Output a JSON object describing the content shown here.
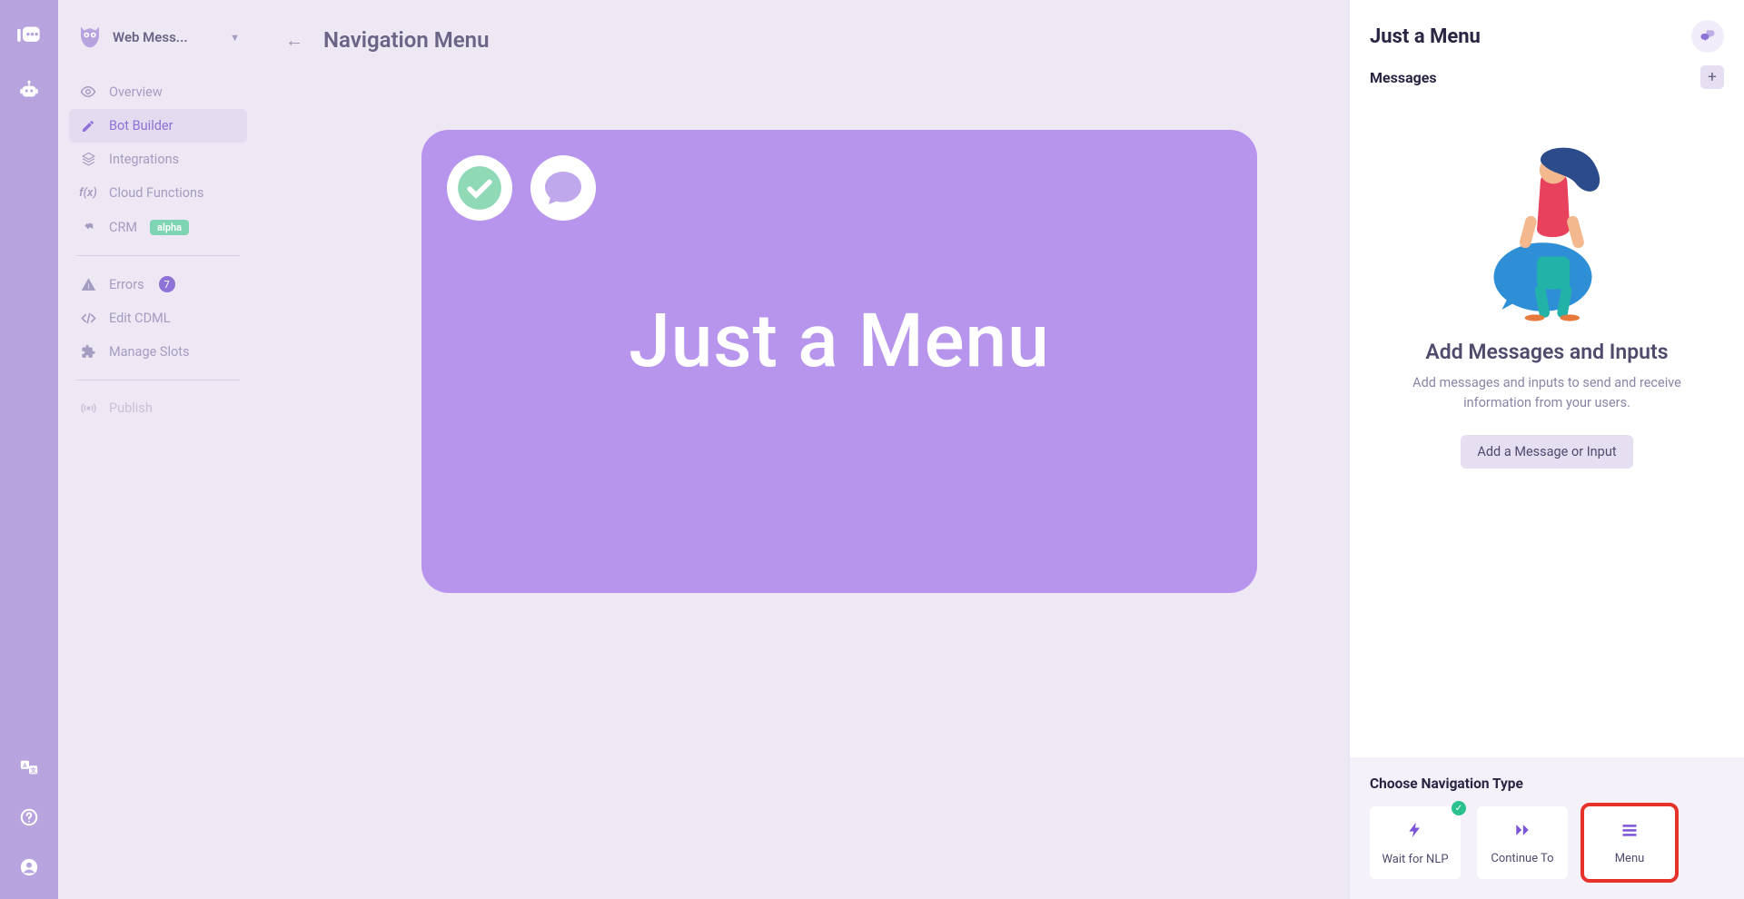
{
  "sidebar": {
    "title": "Web Mess...",
    "items": [
      {
        "label": "Overview"
      },
      {
        "label": "Bot Builder"
      },
      {
        "label": "Integrations"
      },
      {
        "label": "Cloud Functions"
      },
      {
        "label": "CRM",
        "tag": "alpha"
      }
    ],
    "items2": [
      {
        "label": "Errors",
        "badge": "7"
      },
      {
        "label": "Edit CDML"
      },
      {
        "label": "Manage Slots"
      }
    ],
    "items3": [
      {
        "label": "Publish"
      }
    ]
  },
  "main": {
    "page_title": "Navigation Menu",
    "node_title": "Just a Menu"
  },
  "rpanel": {
    "title": "Just a Menu",
    "section": "Messages",
    "empty_heading": "Add Messages and Inputs",
    "empty_text": "Add messages and inputs to send and receive information from your users.",
    "add_button": "Add a Message or Input",
    "nav_title": "Choose Navigation Type",
    "nav_types": [
      {
        "label": "Wait for NLP"
      },
      {
        "label": "Continue To"
      },
      {
        "label": "Menu"
      }
    ]
  }
}
